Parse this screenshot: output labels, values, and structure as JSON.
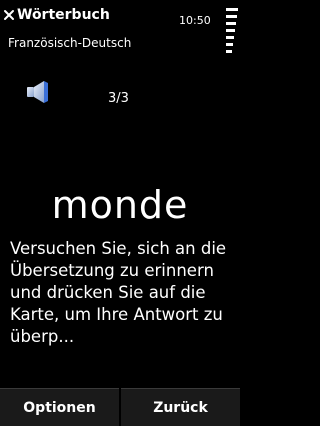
{
  "titlebar": {
    "title": "Wörterbuch",
    "time": "10:50"
  },
  "subtitle": "Französisch-Deutsch",
  "card": {
    "counter": "3/3",
    "word": "monde",
    "instruction": "Versuchen Sie, sich an die Übersetzung zu erinnern und drücken Sie auf die Karte, um Ihre Antwort zu überp..."
  },
  "softkeys": {
    "left": "Optionen",
    "right": "Zurück"
  },
  "icons": {
    "close": "close-icon",
    "speaker": "speaker-icon",
    "signal": "signal-strength-icon"
  },
  "colors": {
    "background": "#000000",
    "text": "#ffffff",
    "speaker_accent": "#3a6fd8"
  }
}
